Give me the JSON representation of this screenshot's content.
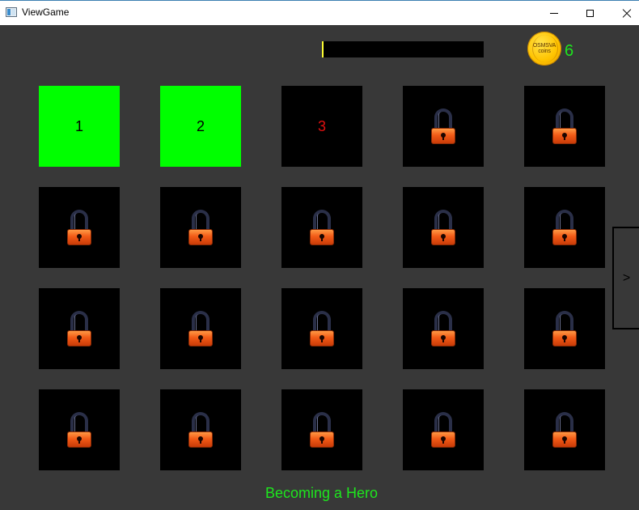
{
  "window": {
    "title": "ViewGame",
    "icons": {
      "app": "app-window-icon",
      "minimize": "minimize-icon",
      "maximize": "maximize-icon",
      "close": "close-icon"
    }
  },
  "hud": {
    "progress_fraction": 0.0,
    "progress_colors": {
      "track": "#000000",
      "marker": "#ffff33"
    },
    "coin_label_line1": "OSMSVA",
    "coin_label_line2": "coins",
    "coin_count": "6",
    "coin_color": "#ffc400",
    "count_color": "#1ee61e"
  },
  "levels": [
    {
      "label": "1",
      "state": "completed"
    },
    {
      "label": "2",
      "state": "completed"
    },
    {
      "label": "3",
      "state": "current"
    },
    {
      "label": "",
      "state": "locked"
    },
    {
      "label": "",
      "state": "locked"
    },
    {
      "label": "",
      "state": "locked"
    },
    {
      "label": "",
      "state": "locked"
    },
    {
      "label": "",
      "state": "locked"
    },
    {
      "label": "",
      "state": "locked"
    },
    {
      "label": "",
      "state": "locked"
    },
    {
      "label": "",
      "state": "locked"
    },
    {
      "label": "",
      "state": "locked"
    },
    {
      "label": "",
      "state": "locked"
    },
    {
      "label": "",
      "state": "locked"
    },
    {
      "label": "",
      "state": "locked"
    },
    {
      "label": "",
      "state": "locked"
    },
    {
      "label": "",
      "state": "locked"
    },
    {
      "label": "",
      "state": "locked"
    },
    {
      "label": "",
      "state": "locked"
    },
    {
      "label": "",
      "state": "locked"
    }
  ],
  "level_colors": {
    "completed": "#00ff00",
    "locked": "#000000",
    "current_text": "#e01010"
  },
  "lock_icon": "padlock-icon",
  "next_button_label": ">",
  "footer_title": "Becoming a Hero",
  "background_color": "#383838"
}
